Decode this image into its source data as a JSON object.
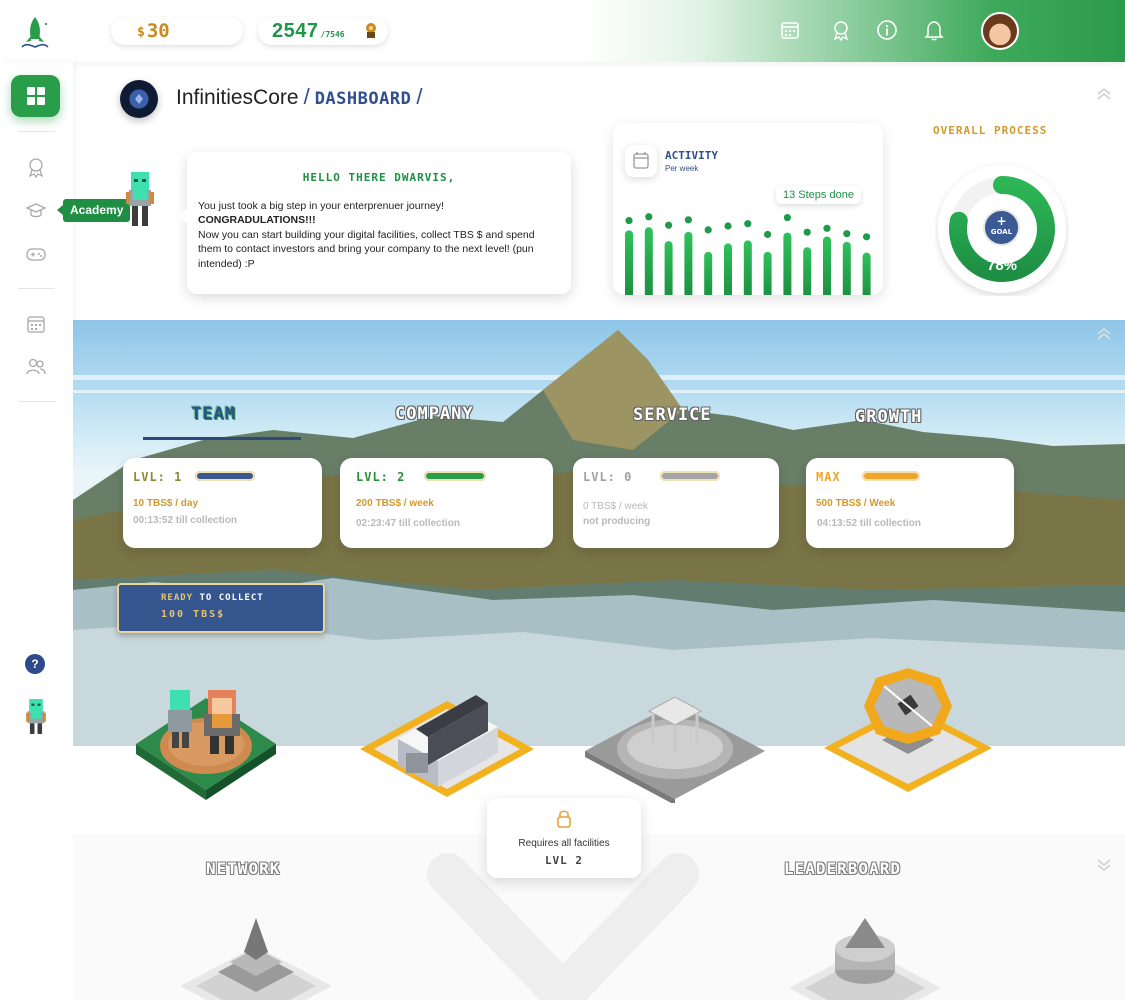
{
  "topbar": {
    "currency_symbol": "$",
    "money": "30",
    "points": "2547",
    "points_max": "/7546",
    "icons": [
      "calendar-icon",
      "rocket-badge-icon",
      "info-icon",
      "bell-icon"
    ]
  },
  "sidebar": {
    "tooltip": "Academy",
    "help": "?",
    "items": [
      "dashboard",
      "rocket",
      "academy",
      "games",
      "calendar",
      "team"
    ]
  },
  "header": {
    "company": "InfinitiesCore",
    "sep1": "/",
    "page": "DASHBOARD",
    "sep2": "/"
  },
  "greeting": {
    "title": "HELLO THERE DWARVIS,",
    "line1": "You just took a big step in your enterprenuer journey!",
    "line2": "CONGRADULATIONS!!!",
    "line3": "Now you can start building your digital facilities, collect TBS $ and spend them to contact investors and bring your company to the next level! (pun intended) :P"
  },
  "activity": {
    "title": "ACTIVITY",
    "subtitle": "Per week",
    "steps": "13 Steps done"
  },
  "chart_data": {
    "type": "bar",
    "series": [
      {
        "values": [
          0.84,
          0.88,
          0.7,
          0.82,
          0.56,
          0.67,
          0.71,
          0.56,
          0.81,
          0.62,
          0.76,
          0.69,
          0.55
        ]
      }
    ],
    "dots": [
      0.94,
      0.99,
      0.88,
      0.95,
      0.82,
      0.87,
      0.9,
      0.76,
      0.98,
      0.79,
      0.84,
      0.77,
      0.73
    ]
  },
  "overall": {
    "title": "OVERALL PROCESS",
    "goal_plus": "+",
    "goal_label": "GOAL",
    "percent": "78%",
    "progress": 0.78
  },
  "tabs": {
    "team": "TEAM",
    "company": "COMPANY",
    "service": "SERVICE",
    "growth": "GROWTH"
  },
  "facilities": {
    "team": {
      "level": "LVL: 1",
      "rate_amount": "10 TBS$",
      "rate_unit": " / day",
      "till": "00:13:52 till collection",
      "bar_fill": 1.0
    },
    "company": {
      "level": "LVL: 2",
      "rate_amount": "200 TBS$",
      "rate_unit": " / week",
      "till": "02:23:47 till collection",
      "bar_fill": 1.0
    },
    "service": {
      "level": "LVL: 0",
      "rate": "0 TBS$ / week",
      "till": "not producing",
      "bar_fill": 1.0
    },
    "growth": {
      "level": "MAX",
      "rate_amount": "500 TBS$",
      "rate_unit": " / Week",
      "till": "04:13:52 till collection",
      "bar_fill": 1.0
    }
  },
  "collect": {
    "ready": "READY",
    "to_collect": " TO COLLECT",
    "amount": "100 TBS$"
  },
  "lock": {
    "text": "Requires all facilities",
    "level": "LVL 2"
  },
  "section2": {
    "network": "NETWORK",
    "leaderboard": "LEADERBOARD"
  },
  "colors": {
    "green": "#2a9d4b",
    "navy": "#2f4f8f",
    "gold": "#d19a2a"
  }
}
